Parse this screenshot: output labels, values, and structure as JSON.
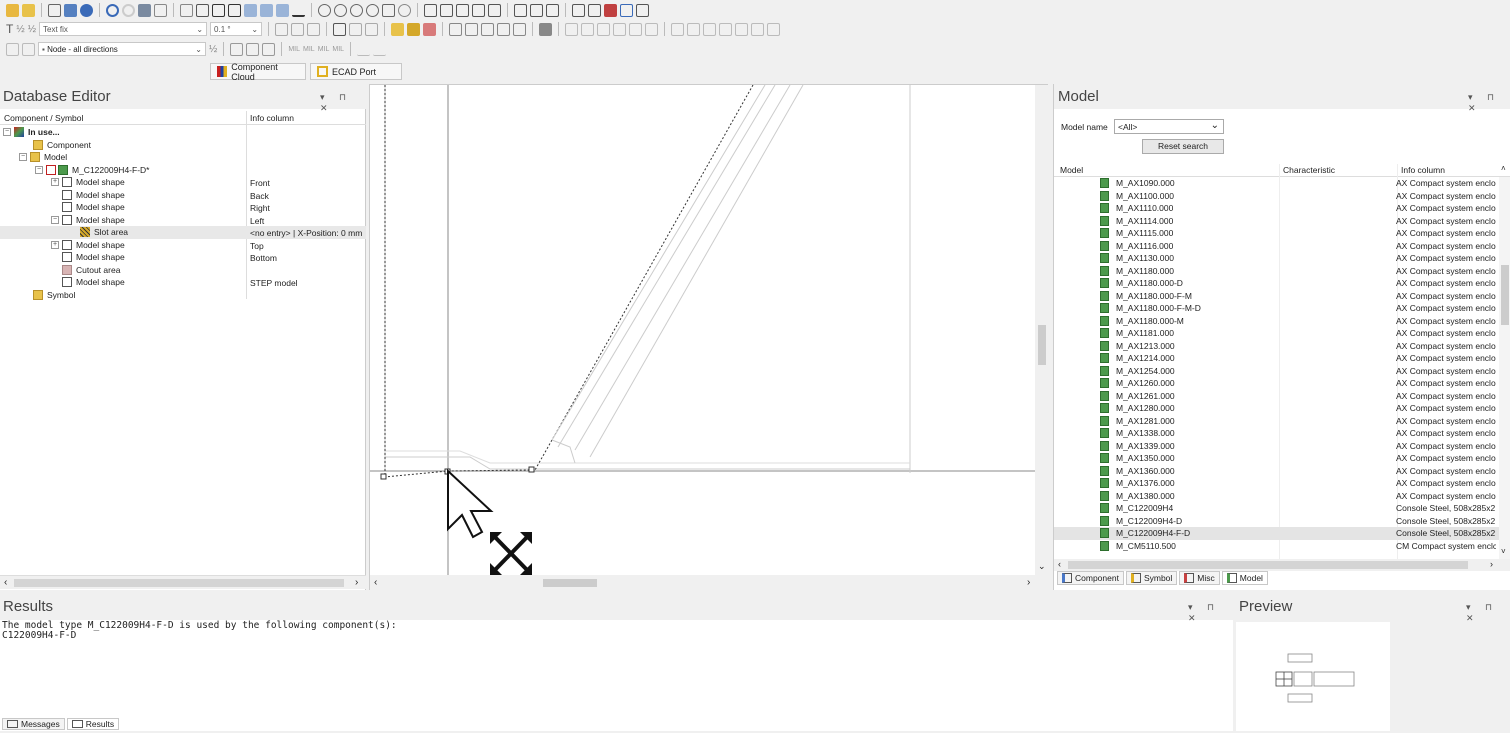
{
  "toolbar": {
    "row2_text_combo": "Text fix",
    "row2_size_combo": "0.1 °",
    "row3_node_combo": "Node - all directions",
    "row3_mil_labels": [
      "MIL",
      "MIL",
      "MIL",
      "MIL"
    ],
    "component_cloud_label": "Component Cloud",
    "ecad_port_label": "ECAD Port"
  },
  "database_editor": {
    "title": "Database Editor",
    "controls": "▾ ⊓ ✕",
    "col_component": "Component / Symbol",
    "col_info": "Info column",
    "rows": [
      {
        "label": "In use...",
        "info": "",
        "bold": true
      },
      {
        "label": "Component",
        "info": ""
      },
      {
        "label": "Model",
        "info": ""
      },
      {
        "label": "M_C122009H4-F-D*",
        "info": ""
      },
      {
        "label": "Model shape",
        "info": "Front"
      },
      {
        "label": "Model shape",
        "info": "Back"
      },
      {
        "label": "Model shape",
        "info": "Right"
      },
      {
        "label": "Model shape",
        "info": "Left"
      },
      {
        "label": "Slot area",
        "info": "<no entry> | X-Position: 0 mm"
      },
      {
        "label": "Model shape",
        "info": "Top"
      },
      {
        "label": "Model shape",
        "info": "Bottom"
      },
      {
        "label": "Cutout area",
        "info": ""
      },
      {
        "label": "Model shape",
        "info": "STEP model"
      },
      {
        "label": "Symbol",
        "info": ""
      }
    ]
  },
  "model_panel": {
    "title": "Model",
    "controls": "▾ ⊓ ✕",
    "model_name_label": "Model name",
    "model_name_value": "<All>",
    "reset_button": "Reset search",
    "col_model": "Model",
    "col_characteristic": "Characteristic",
    "col_info": "Info column",
    "rows": [
      {
        "name": "M_AX1090.000",
        "info": "AX Compact system enclo"
      },
      {
        "name": "M_AX1100.000",
        "info": "AX Compact system enclo"
      },
      {
        "name": "M_AX1110.000",
        "info": "AX Compact system enclo"
      },
      {
        "name": "M_AX1114.000",
        "info": "AX Compact system enclo"
      },
      {
        "name": "M_AX1115.000",
        "info": "AX Compact system enclo"
      },
      {
        "name": "M_AX1116.000",
        "info": "AX Compact system enclo"
      },
      {
        "name": "M_AX1130.000",
        "info": "AX Compact system enclo"
      },
      {
        "name": "M_AX1180.000",
        "info": "AX Compact system enclo"
      },
      {
        "name": "M_AX1180.000-D",
        "info": "AX Compact system enclo"
      },
      {
        "name": "M_AX1180.000-F-M",
        "info": "AX Compact system enclo"
      },
      {
        "name": "M_AX1180.000-F-M-D",
        "info": "AX Compact system enclo"
      },
      {
        "name": "M_AX1180.000-M",
        "info": "AX Compact system enclo"
      },
      {
        "name": "M_AX1181.000",
        "info": "AX Compact system enclo"
      },
      {
        "name": "M_AX1213.000",
        "info": "AX Compact system enclo"
      },
      {
        "name": "M_AX1214.000",
        "info": "AX Compact system enclo"
      },
      {
        "name": "M_AX1254.000",
        "info": "AX Compact system enclo"
      },
      {
        "name": "M_AX1260.000",
        "info": "AX Compact system enclo"
      },
      {
        "name": "M_AX1261.000",
        "info": "AX Compact system enclo"
      },
      {
        "name": "M_AX1280.000",
        "info": "AX Compact system enclo"
      },
      {
        "name": "M_AX1281.000",
        "info": "AX Compact system enclo"
      },
      {
        "name": "M_AX1338.000",
        "info": "AX Compact system enclo"
      },
      {
        "name": "M_AX1339.000",
        "info": "AX Compact system enclo"
      },
      {
        "name": "M_AX1350.000",
        "info": "AX Compact system enclo"
      },
      {
        "name": "M_AX1360.000",
        "info": "AX Compact system enclo"
      },
      {
        "name": "M_AX1376.000",
        "info": "AX Compact system enclo"
      },
      {
        "name": "M_AX1380.000",
        "info": "AX Compact system enclo"
      },
      {
        "name": "M_C122009H4",
        "info": "Console Steel, 508x285x2"
      },
      {
        "name": "M_C122009H4-D",
        "info": "Console Steel, 508x285x2"
      },
      {
        "name": "M_C122009H4-F-D",
        "info": "Console Steel, 508x285x2",
        "selected": true
      },
      {
        "name": "M_CM5110.500",
        "info": "CM Compact system enclc"
      }
    ],
    "tabs": [
      {
        "label": "Component",
        "color": "#4a78c8"
      },
      {
        "label": "Symbol",
        "color": "#e0b020"
      },
      {
        "label": "Misc",
        "color": "#c84040"
      },
      {
        "label": "Model",
        "color": "#4c9a4c",
        "active": true
      }
    ]
  },
  "results": {
    "title": "Results",
    "controls": "▾ ⊓ ✕",
    "line1": "The model type M_C122009H4-F-D is used by the following component(s):",
    "line2": "C122009H4-F-D",
    "tab_messages": "Messages",
    "tab_results": "Results"
  },
  "preview": {
    "title": "Preview",
    "controls": "▾ ⊓ ✕"
  }
}
